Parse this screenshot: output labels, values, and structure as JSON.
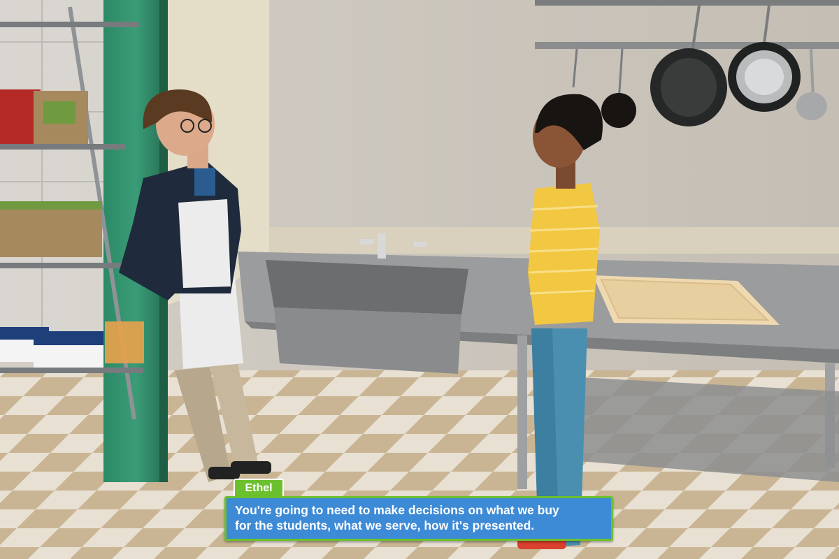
{
  "dialog": {
    "speaker": "Ethel",
    "lines": [
      "You're going to need to make decisions on what we buy",
      "for the students, what we serve, how it's presented."
    ]
  },
  "colors": {
    "dialog_background": "#3d8ad6",
    "dialog_border": "#6cc02e",
    "speaker_tab": "#6cc02e",
    "dialog_text": "#ffffff"
  }
}
